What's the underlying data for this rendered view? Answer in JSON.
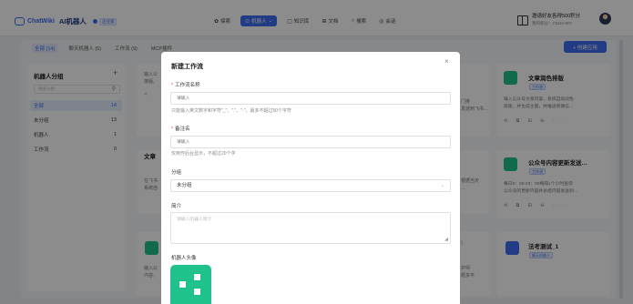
{
  "header": {
    "logo_text": "ChatWiki",
    "logo_sub": "AI机器人",
    "version_tag": "企业版",
    "nav": [
      {
        "label": "探索",
        "icon": "compass-icon",
        "glyph": "✿",
        "active": false
      },
      {
        "label": "机器人",
        "icon": "robot-icon",
        "glyph": "⊙",
        "active": true
      },
      {
        "label": "知识库",
        "icon": "book-icon",
        "glyph": "▢",
        "active": false
      },
      {
        "label": "文档",
        "icon": "doc-icon",
        "glyph": "⊞",
        "active": false
      },
      {
        "label": "搜索",
        "icon": "search-icon",
        "glyph": "○",
        "active": false
      },
      {
        "label": "会话",
        "icon": "chat-icon",
        "glyph": "◎",
        "active": false
      }
    ],
    "invite_title": "邀请好友各得500积分",
    "invite_sub": "我的积分：74634·807"
  },
  "tabs": [
    "全部 (14)",
    "聊天机器人 (5)",
    "工作流 (9)",
    "MCP插件"
  ],
  "create_button": "+ 创建应用",
  "sidebar": {
    "title": "机器人分组",
    "add": "+",
    "search_placeholder": "搜索分组",
    "groups": [
      {
        "label": "全部",
        "count": "14",
        "active": true
      },
      {
        "label": "未分组",
        "count": "13",
        "active": false
      },
      {
        "label": "机器人",
        "count": "1",
        "active": false
      },
      {
        "label": "工作流",
        "count": "0",
        "active": false
      }
    ]
  },
  "cards": {
    "c1": {
      "title": "文章润色排版",
      "badge": "工作流",
      "desc1": "输入公众号文章内容，系统自动润色",
      "desc2": "排版，并生成主图，并推送到微信…",
      "acts": "⟲ ⧉ ⊟ ⊖ ···"
    },
    "c2": {
      "title": "公众号内容更新发送…",
      "badge": "工作流",
      "desc1": "每日9：00-23：00每隔1个小时查询",
      "desc2": "公众号的更新内容并总结内容发送到…",
      "acts": "⟲ ⧉ ⊟ ⊖ ···"
    },
    "c3": {
      "title": "法考测试_1",
      "badge": "聊天机器人"
    }
  },
  "fragments": {
    "l1a": "输入公",
    "l1b": "排版,",
    "l1c": "✧ ",
    "l2t": "文章",
    "l2a": "在飞书",
    "l2b": "系统自",
    "l3a": "输入公",
    "l3b": "内容,",
    "r1a": "门排",
    "r1b": "发送到飞书…",
    "r2a": "根据当天",
    "r2b": "…",
    "r3a": ")",
    "r3b": "护师",
    "r3c": "题多平"
  },
  "modal": {
    "title": "新建工作流",
    "close": "×",
    "name_label": "工作流名称",
    "name_placeholder": "请输入",
    "name_hint": "只能输入英文数字和字符\"_\"、\".\"、\"-\"，最多不超过50个字符",
    "remark_label": "备注名",
    "remark_placeholder": "请输入",
    "remark_hint": "仅用作后台显示，不超过20个字",
    "group_label": "分组",
    "group_value": "未分组",
    "intro_label": "简介",
    "intro_placeholder": "请输入机器人简介",
    "avatar_label": "机器人头像"
  },
  "colors": {
    "primary": "#3d6cf0",
    "avatar_green": "#1fc28a",
    "required": "#e5484d"
  }
}
